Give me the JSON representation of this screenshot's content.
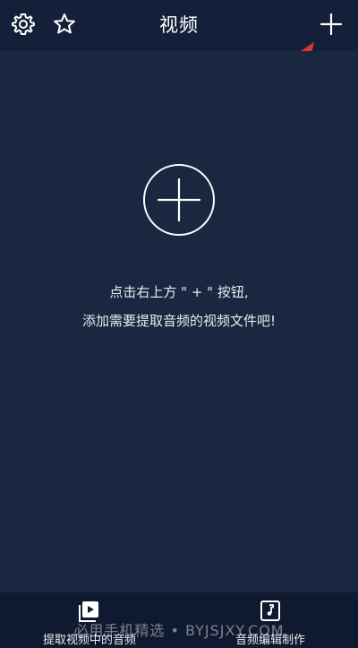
{
  "header": {
    "title": "视频",
    "icons": [
      "gear-icon",
      "star-icon",
      "plus-icon"
    ]
  },
  "main": {
    "center_icon": "plus-circle-icon",
    "message_line1": "点击右上方 \" + \" 按钮,",
    "message_line2": "添加需要提取音频的视频文件吧!"
  },
  "bottom_tabs": [
    {
      "label": "提取视频中的音频",
      "icon": "video-play-icon"
    },
    {
      "label": "音频编辑制作",
      "icon": "music-note-icon"
    }
  ],
  "watermark": "必用手机精选 • BYJSJXY.COM",
  "colors": {
    "background": "#1a2740",
    "header": "#14203a",
    "bottom_bar": "#0f1a30",
    "annotation_arrow": "#e0352b"
  }
}
